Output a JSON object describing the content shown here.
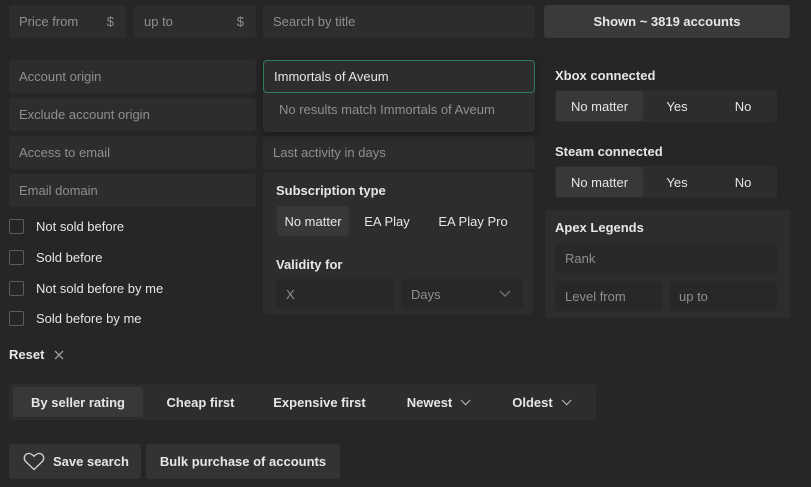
{
  "price": {
    "from_placeholder": "Price from",
    "to_placeholder": "up to",
    "currency": "$"
  },
  "search": {
    "placeholder": "Search by title"
  },
  "shown_button": "Shown ~ 3819 accounts",
  "left_fields": {
    "account_origin": "Account origin",
    "exclude_account_origin": "Exclude account origin",
    "access_to_email": "Access to email",
    "email_domain": "Email domain"
  },
  "checkboxes": [
    "Not sold before",
    "Sold before",
    "Not sold before by me",
    "Sold before by me"
  ],
  "reset": {
    "label": "Reset",
    "icon": "close-icon"
  },
  "title_dropdown": {
    "value": "Immortals of Aveum",
    "empty_message": "No results match Immortals of Aveum"
  },
  "last_activity": {
    "placeholder": "Last activity in days"
  },
  "subscription": {
    "title": "Subscription type",
    "options": [
      "No matter",
      "EA Play",
      "EA Play Pro"
    ]
  },
  "validity": {
    "title": "Validity for",
    "value_placeholder": "X",
    "unit": "Days"
  },
  "xbox": {
    "title": "Xbox connected",
    "options": [
      "No matter",
      "Yes",
      "No"
    ]
  },
  "steam": {
    "title": "Steam connected",
    "options": [
      "No matter",
      "Yes",
      "No"
    ]
  },
  "apex": {
    "title": "Apex Legends",
    "rank_placeholder": "Rank",
    "level_from_placeholder": "Level from",
    "level_to_placeholder": "up to"
  },
  "sort": [
    "By seller rating",
    "Cheap first",
    "Expensive first",
    "Newest",
    "Oldest"
  ],
  "bottom": {
    "save_search": "Save search",
    "bulk_purchase": "Bulk purchase of accounts"
  },
  "colors": {
    "background": "#262626",
    "field": "#2d2d2d",
    "focus_border": "#2e7d55",
    "text": "#e6e6e6",
    "muted": "#8f8f8f"
  }
}
